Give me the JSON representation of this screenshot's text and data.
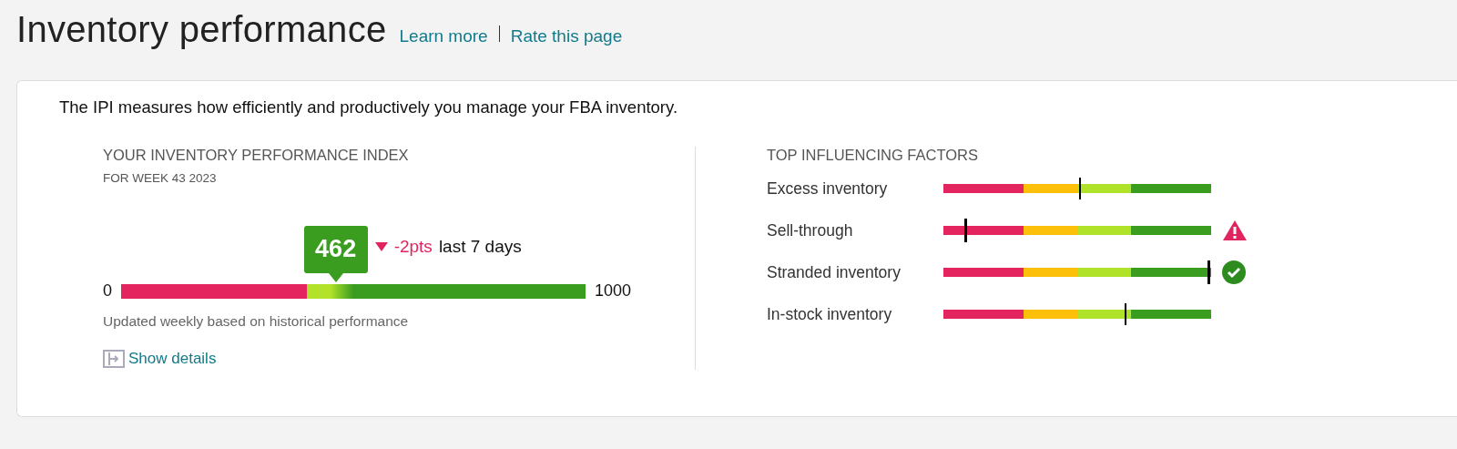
{
  "header": {
    "title": "Inventory performance",
    "links": [
      "Learn more",
      "Rate this page"
    ]
  },
  "card": {
    "intro": "The IPI measures how efficiently and productively you manage your FBA inventory.",
    "index": {
      "heading": "YOUR INVENTORY PERFORMANCE INDEX",
      "week": "FOR WEEK 43 2023",
      "score": "462",
      "level": 0.462,
      "change": "-2pts",
      "change_period": "last 7 days",
      "min": "0",
      "max": "1000",
      "note": "Updated weekly based on historical performance",
      "details_link": "Show details"
    },
    "factors": {
      "heading": "TOP INFLUENCING FACTORS",
      "items": [
        {
          "label": "Excess inventory",
          "level": 0.51,
          "kind": "none"
        },
        {
          "label": "Sell-through",
          "level": 0.08,
          "kind": "warning"
        },
        {
          "label": "Stranded inventory",
          "level": 0.99,
          "kind": "ok"
        },
        {
          "label": "In-stock inventory",
          "level": 0.68,
          "kind": "none"
        }
      ]
    }
  }
}
